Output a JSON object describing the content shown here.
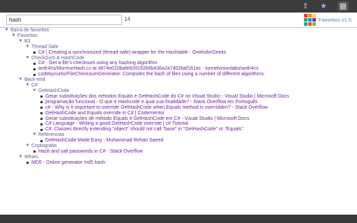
{
  "browser": {
    "icons": [
      {
        "name": "share-icon",
        "glyph": "⇪"
      },
      {
        "name": "star-icon",
        "glyph": "★"
      },
      {
        "name": "extension-icon",
        "glyph": "▦"
      }
    ]
  },
  "popup": {
    "search_value": "hash",
    "result_count": "14",
    "app_name": "Favoritos v1.5",
    "logo_colors": [
      "#e53935",
      "#fb8c00",
      "#fdd835",
      "#43a047",
      "#1e88e5",
      "#8e24aa",
      "#00acc1",
      "#f4511e",
      "#7cb342"
    ]
  },
  "tree": {
    "root": "Barra de favoritos",
    "favoritos": "Favoritos",
    "b3": "B3",
    "thread_safe": "Thread Safe",
    "thread_safe_items": [
      "C# | Creating a synchronized (thread-safe) wrapper for the Hashtable - GeeksforGeeks"
    ],
    "checksum": "CheckSum & HashCode",
    "checksum_items": [
      "C# - Get a file's checksum using any hashing algorithm",
      "antlr4cs/MurmurHash.cs at 4874e010bafe828192b6b436a2a7d02baf161ec · tunnelvisionlabs/antlr4cs",
      "codebycurtis/FileChecksumGenerator: Computes the hash of files using a number of different algorithms."
    ],
    "backend": "Back-end",
    "csharp": "C#",
    "gethashcode": "GetHashCode",
    "gethashcode_items": [
      "Gerar substituições dos métodos Equals e GetHashCode do C# no Visual Studio - Visual Studio | Microsoft Docs",
      "programação funcional - O que é Hashcode e qual sua finalidade? - Stack Overflow em Português",
      "c# - Why is it important to override GetHashCode when Equals method is overridden? - Stack Overflow",
      "GetHashCode and Equals override in C# | Codementor",
      "Gerar substituições de método Equals e GetHashCode em C# - Visual Studio | Microsoft Docs",
      "C# Language - Writing a good GetHashCode override | c# Tutorial",
      "C#: Classes directly extending \"object\" should not call \"base\" in \"GetHashCode\" or \"Equals\""
    ],
    "referencias": "Referencias",
    "referencias_items": [
      "GetHashCode Made Easy - Muhammad Rehan Saeed"
    ],
    "criptografia": "Criptografia",
    "criptografia_items": [
      "Hash and salt passwords in C# - Stack Overflow"
    ],
    "whats": "Whats",
    "whats_items": [
      "MD5 - Online generator md5 hash"
    ]
  }
}
